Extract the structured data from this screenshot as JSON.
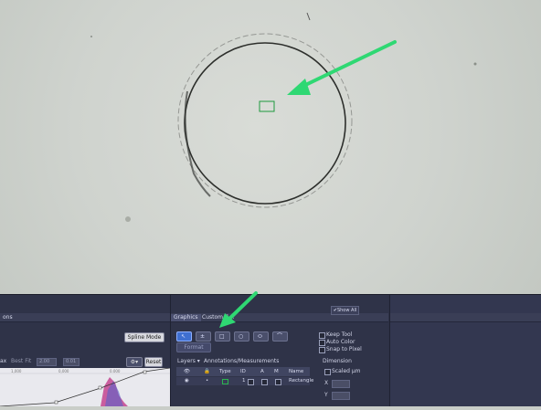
{
  "left_pane": {
    "tab_label": "ons",
    "spline_mode_label": "Spline Mode",
    "ax_label": "ax",
    "best_fit_label": "Best Fit",
    "best_fit_value": "2.00",
    "second_value": "0.01",
    "reset_label": "Reset",
    "chart_ticks": [
      "1,000",
      "0,000",
      "0.000"
    ]
  },
  "graphics": {
    "tabs": [
      "Graphics",
      "Custom G..."
    ],
    "format_label": "Format",
    "layers_label": "Layers",
    "annotations_label": "Annotations/Measurements",
    "table_headers": [
      "Type",
      "ID",
      "A",
      "M",
      "Name"
    ],
    "table_row": {
      "id": "1",
      "name": "Rectangle"
    }
  },
  "options": {
    "keep_tool": "Keep Tool",
    "auto_color": "Auto Color",
    "snap_to_pixel": "Snap to Pixel",
    "dimension_label": "Dimension",
    "scaled_label": "Scaled μm",
    "x_label": "X",
    "y_label": "Y"
  },
  "show_all_label": "Show All",
  "colors": {
    "arrow": "#2fd873",
    "roi": "#1e9a3e",
    "panel_bg": "#2e3146",
    "selected_tool": "#3f6fd0"
  }
}
